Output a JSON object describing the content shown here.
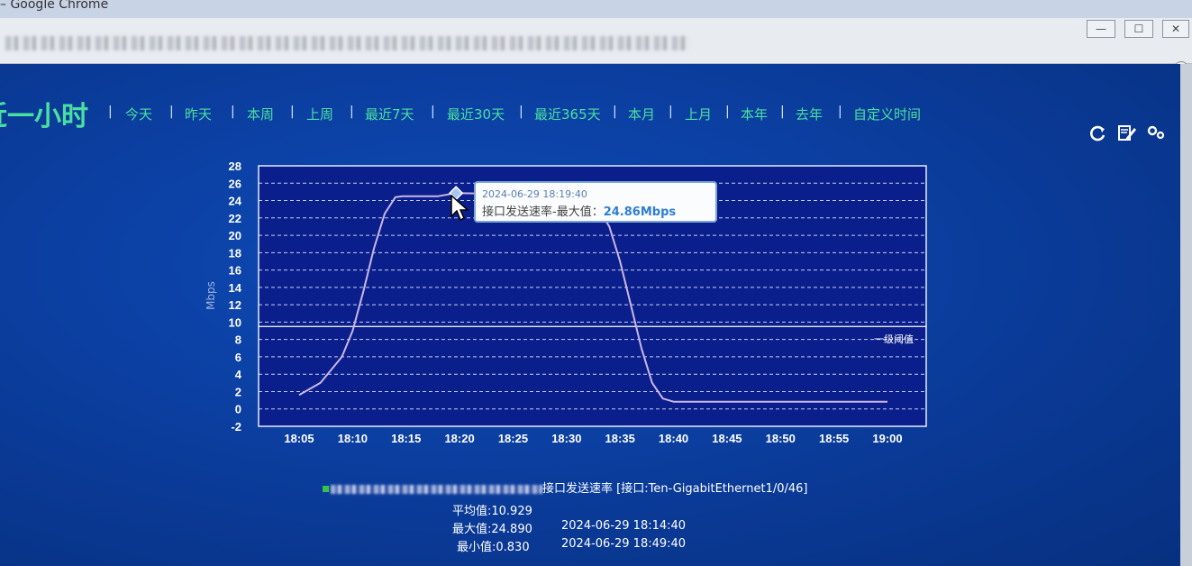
{
  "browser": {
    "title": "– Google Chrome",
    "window_buttons": [
      "—",
      "☐",
      "✕"
    ]
  },
  "nav": {
    "title": "近一小时",
    "items": [
      "今天",
      "昨天",
      "本周",
      "上周",
      "最近7天",
      "最近30天",
      "最近365天",
      "本月",
      "上月",
      "本年",
      "去年",
      "自定义时间"
    ]
  },
  "toolbar": {
    "refresh_icon": "refresh-icon",
    "edit_icon": "edit-icon",
    "settings_icon": "settings-icon"
  },
  "chart_data": {
    "type": "line",
    "ylabel": "Mbps",
    "ylim": [
      -2,
      28
    ],
    "yticks": [
      "28",
      "26",
      "24",
      "22",
      "20",
      "18",
      "16",
      "14",
      "12",
      "10",
      "8",
      "6",
      "4",
      "2",
      "0",
      "-2"
    ],
    "x_ticks": [
      "18:05",
      "18:10",
      "18:15",
      "18:20",
      "18:25",
      "18:30",
      "18:35",
      "18:40",
      "18:45",
      "18:50",
      "18:55",
      "19:00"
    ],
    "threshold_label": "一级阈值",
    "threshold_value": 9.5,
    "series": [
      {
        "name": "接口发送速率",
        "x": [
          "18:05",
          "18:07",
          "18:09",
          "18:10",
          "18:11",
          "18:12",
          "18:13",
          "18:14",
          "18:14:40",
          "18:16",
          "18:18",
          "18:19:40",
          "18:22",
          "18:25",
          "18:28",
          "18:31",
          "18:33",
          "18:34",
          "18:35",
          "18:36",
          "18:37",
          "18:38",
          "18:39",
          "18:40",
          "18:42",
          "18:45",
          "18:49:40",
          "18:55",
          "19:00"
        ],
        "values": [
          1.6,
          3.0,
          6.0,
          9.0,
          13.5,
          18.5,
          22.5,
          24.4,
          24.5,
          24.5,
          24.5,
          24.86,
          24.8,
          24.8,
          24.7,
          24.6,
          23.0,
          21.0,
          17.0,
          12.0,
          7.0,
          3.0,
          1.2,
          0.83,
          0.83,
          0.83,
          0.83,
          0.83,
          0.83
        ]
      }
    ],
    "grid": true,
    "tooltip": {
      "timestamp": "2024-06-29 18:19:40",
      "label": "接口发送速率-最大值：",
      "value": "24.86Mbps"
    }
  },
  "stats": {
    "legend_text": "接口发送速率 [接口:Ten-GigabitEthernet1/0/46]",
    "avg": "平均值:10.929",
    "max": "最大值:24.890",
    "max_time": "2024-06-29 18:14:40",
    "min": "最小值:0.830",
    "min_time": "2024-06-29 18:49:40"
  }
}
